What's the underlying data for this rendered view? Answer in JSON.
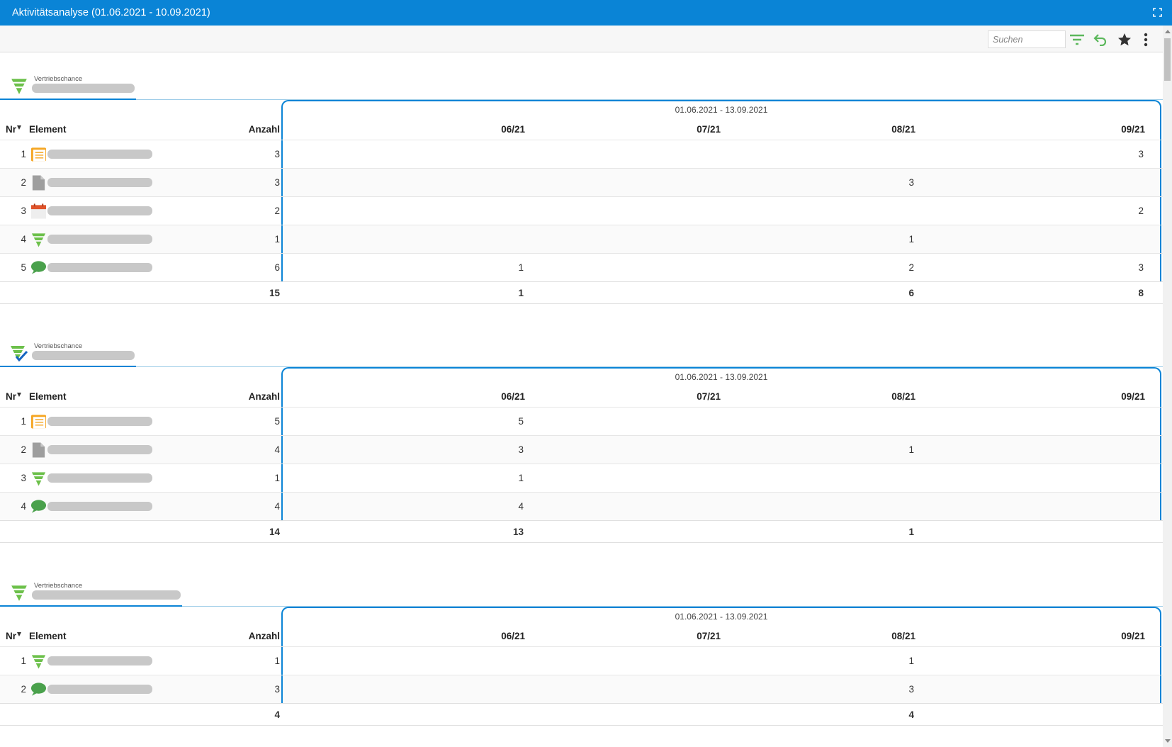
{
  "window": {
    "title": "Aktivitätsanalyse (01.06.2021 - 10.09.2021)"
  },
  "toolbar": {
    "search_placeholder": "Suchen"
  },
  "columns": {
    "nr": "Nr",
    "element": "Element",
    "count": "Anzahl",
    "months": [
      "06/21",
      "07/21",
      "08/21",
      "09/21"
    ]
  },
  "sections": [
    {
      "label": "Vertriebschance",
      "icon": "funnel-icon",
      "period": "01.06.2021 - 13.09.2021",
      "rows": [
        {
          "nr": "1",
          "icon": "note-icon",
          "count": "3",
          "m": [
            "",
            "",
            "",
            "3"
          ]
        },
        {
          "nr": "2",
          "icon": "document-icon",
          "count": "3",
          "m": [
            "",
            "",
            "3",
            ""
          ]
        },
        {
          "nr": "3",
          "icon": "calendar-icon",
          "count": "2",
          "m": [
            "",
            "",
            "",
            "2"
          ]
        },
        {
          "nr": "4",
          "icon": "funnel-icon",
          "count": "1",
          "m": [
            "",
            "",
            "1",
            ""
          ]
        },
        {
          "nr": "5",
          "icon": "chat-icon",
          "count": "6",
          "m": [
            "1",
            "",
            "2",
            "3"
          ]
        }
      ],
      "total": {
        "count": "15",
        "m": [
          "1",
          "",
          "6",
          "8"
        ]
      }
    },
    {
      "label": "Vertriebschance",
      "icon": "funnel-check-icon",
      "period": "01.06.2021 - 13.09.2021",
      "rows": [
        {
          "nr": "1",
          "icon": "note-icon",
          "count": "5",
          "m": [
            "5",
            "",
            "",
            ""
          ]
        },
        {
          "nr": "2",
          "icon": "document-icon",
          "count": "4",
          "m": [
            "3",
            "",
            "1",
            ""
          ]
        },
        {
          "nr": "3",
          "icon": "funnel-icon",
          "count": "1",
          "m": [
            "1",
            "",
            "",
            ""
          ]
        },
        {
          "nr": "4",
          "icon": "chat-icon",
          "count": "4",
          "m": [
            "4",
            "",
            "",
            ""
          ]
        }
      ],
      "total": {
        "count": "14",
        "m": [
          "13",
          "",
          "1",
          ""
        ]
      }
    },
    {
      "label": "Vertriebschance",
      "icon": "funnel-icon",
      "period": "01.06.2021 - 13.09.2021",
      "rows": [
        {
          "nr": "1",
          "icon": "funnel-icon",
          "count": "1",
          "m": [
            "",
            "",
            "1",
            ""
          ]
        },
        {
          "nr": "2",
          "icon": "chat-icon",
          "count": "3",
          "m": [
            "",
            "",
            "3",
            ""
          ]
        }
      ],
      "total": {
        "count": "4",
        "m": [
          "",
          "",
          "4",
          ""
        ]
      }
    }
  ]
}
